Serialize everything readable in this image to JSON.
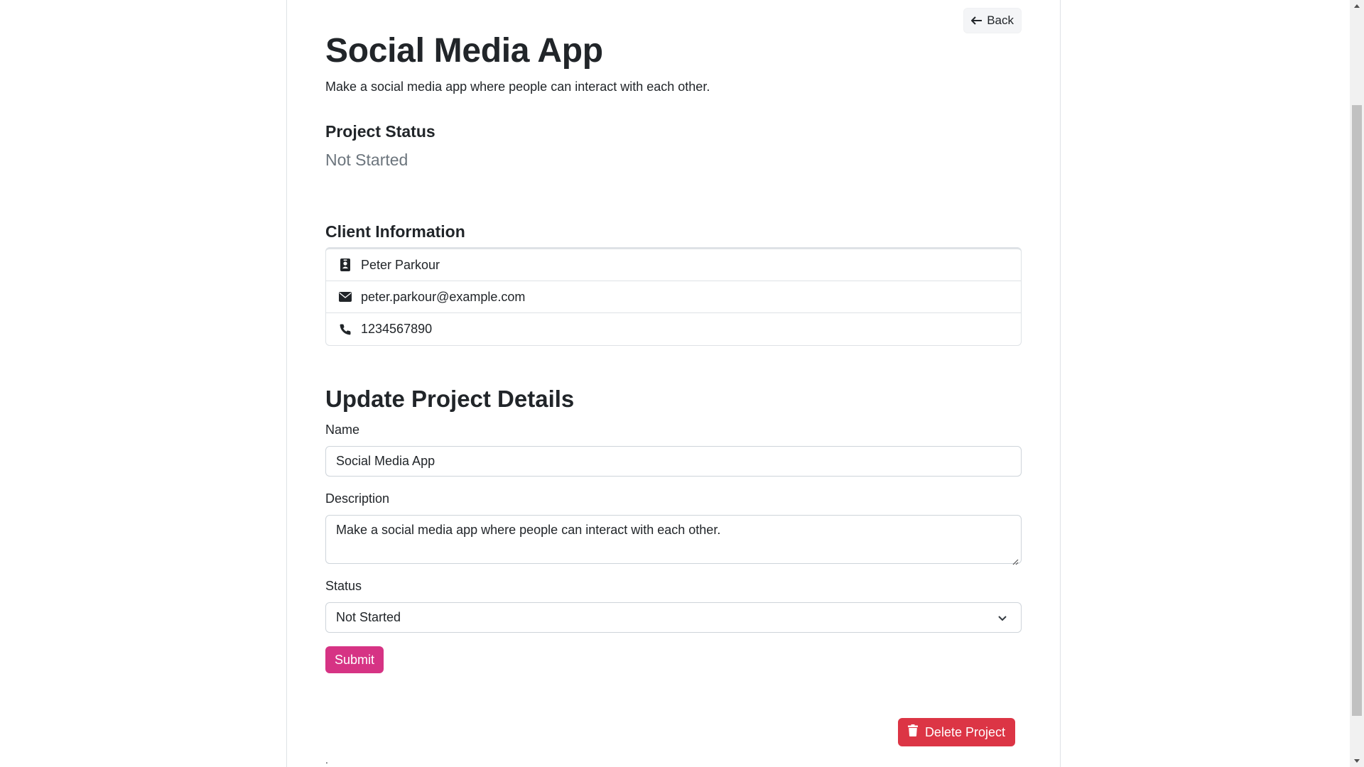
{
  "header": {
    "back_label": "Back",
    "title": "Social Media App",
    "description": "Make a social media app where people can interact with each other."
  },
  "project_status": {
    "heading": "Project Status",
    "value": "Not Started"
  },
  "client": {
    "heading": "Client Information",
    "name": "Peter Parkour",
    "email": "peter.parkour@example.com",
    "phone": "1234567890",
    "icons": [
      "id-badge-icon",
      "envelope-icon",
      "phone-icon"
    ]
  },
  "update_form": {
    "heading": "Update Project Details",
    "name_label": "Name",
    "name_value": "Social Media App",
    "description_label": "Description",
    "description_value": "Make a social media app where people can interact with each other.",
    "status_label": "Status",
    "status_value": "Not Started",
    "submit_label": "Submit"
  },
  "delete": {
    "label": "Delete Project"
  },
  "footer": {
    "dot": "."
  },
  "colors": {
    "submit": "#d63384",
    "delete": "#dc3545",
    "muted": "#6c757d",
    "border": "#dee2e6"
  }
}
